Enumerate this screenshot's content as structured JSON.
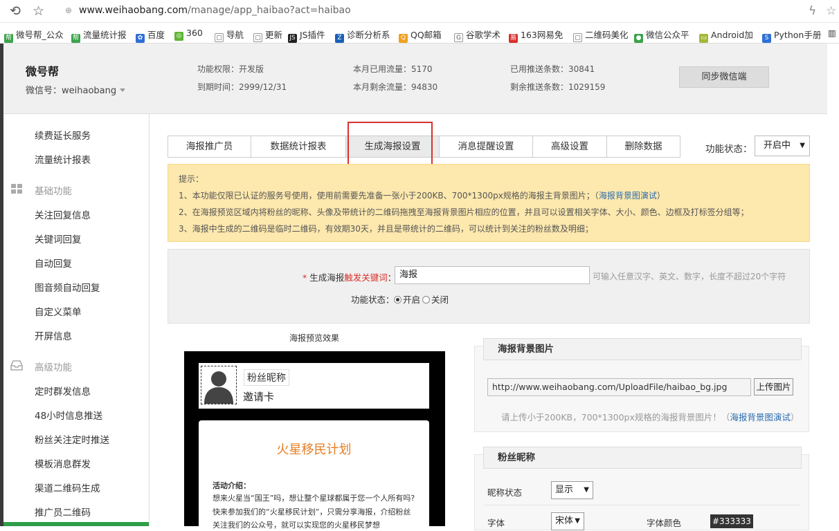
{
  "browser": {
    "url_host": "www.weihaobang.com",
    "url_path": "/manage/app_haibao?act=haibao"
  },
  "bookmarks": [
    {
      "label": "微号帮_公众",
      "color": "#3aa34a",
      "glyph": "帮"
    },
    {
      "label": "流量统计报",
      "color": "#3aa34a",
      "glyph": "帮"
    },
    {
      "label": "百度",
      "color": "#2f6fd6",
      "glyph": "✿"
    },
    {
      "label": "360",
      "color": "#5cb531",
      "glyph": "◎"
    },
    {
      "label": "导航",
      "color": "#ffffff",
      "glyph": "▢"
    },
    {
      "label": "更新",
      "color": "#ffffff",
      "glyph": "▢"
    },
    {
      "label": "JS插件",
      "color": "#222222",
      "glyph": "JS"
    },
    {
      "label": "诊断分析系",
      "color": "#1b5fb8",
      "glyph": "Z"
    },
    {
      "label": "QQ邮箱",
      "color": "#f0a020",
      "glyph": "Q"
    },
    {
      "label": "谷歌学术",
      "color": "#ffffff",
      "glyph": "G"
    },
    {
      "label": "163网易免",
      "color": "#d9302c",
      "glyph": "易"
    },
    {
      "label": "二维码美化",
      "color": "#ffffff",
      "glyph": "▢"
    },
    {
      "label": "微信公众平",
      "color": "#3aa34a",
      "glyph": "●"
    },
    {
      "label": "Android加",
      "color": "#a4b83a",
      "glyph": "▭"
    },
    {
      "label": "Python手册",
      "color": "#2f6fd6",
      "glyph": "S"
    }
  ],
  "header": {
    "title": "微号帮",
    "wechat_id": "微信号：weihaobang",
    "permission": "功能权限：开发版",
    "expire": "到期时间：2999/12/31",
    "used_traffic": "本月已用流量：5170",
    "remain_traffic": "本月剩余流量：94830",
    "used_push": "已用推送条数：30841",
    "remain_push": "剩余推送条数：1029159",
    "sync_button": "同步微信端"
  },
  "sidebar": {
    "items_top": [
      "续费延长服务",
      "流量统计报表"
    ],
    "group_basic": "基础功能",
    "items_basic": [
      "关注回复信息",
      "关键词回复",
      "自动回复",
      "图音频自动回复",
      "自定义菜单",
      "开屏信息"
    ],
    "group_advanced": "高级功能",
    "items_advanced": [
      "定时群发信息",
      "48小时信息推送",
      "粉丝关注定时推送",
      "模板消息群发",
      "渠道二维码生成",
      "推广员二维码"
    ]
  },
  "tabs": [
    "海报推广员",
    "数据统计报表",
    "生成海报设置",
    "消息提醒设置",
    "高级设置",
    "删除数据"
  ],
  "active_tab": "生成海报设置",
  "function_state": {
    "label": "功能状态：",
    "value": "开启中"
  },
  "tips": {
    "title": "提示：",
    "line1": "1、本功能仅限已认证的服务号使用，使用前需要先准备一张小于200KB、700*1300px规格的海报主背景图片；（",
    "line1_link": "海报背景图演试",
    "line1_end": "）",
    "line2": "2、在海报预览区域内将粉丝的昵称、头像及带统计的二维码拖拽至海报背景图片相应的位置，并且可以设置相关字体、大小、颜色、边框及打标签分组等；",
    "line3": "3、海报中生成的二维码是临时二维码，有效期30天，并且是带统计的二维码，可以统计到关注的粉丝数及明细；"
  },
  "form": {
    "keyword_label_pre": "生成海报",
    "keyword_label_red": "触发关键词",
    "keyword_label_colon": "：",
    "keyword_value": "海报",
    "keyword_hint": "可输入任意汉字、英文、数字，长度不超过20个字符",
    "state_label": "功能状态：",
    "state_on": "开启",
    "state_off": "关闭"
  },
  "preview": {
    "title": "海报预览效果",
    "nickname": "粉丝昵称",
    "invite": "邀请卡",
    "headline": "火星移民计划",
    "intro_title": "活动介绍：",
    "intro_1": "想来火星当“国王”吗，想让整个星球都属于您一个人所有吗?",
    "intro_2": "快来参加我们的“火星移民计划”，只需分享海报，介绍粉丝",
    "intro_3": "关注我们的公众号，就可以实现您的火星移民梦想"
  },
  "bg_panel": {
    "title": "海报背景图片",
    "url_value": "http://www.weihaobang.com/UploadFile/haibao_bg.jpg",
    "upload_button": "上传图片",
    "hint": "请上传小于200KB，700*1300px规格的海报背景图片！（",
    "hint_link": "海报背景图演试",
    "hint_end": "）"
  },
  "nick_panel": {
    "title": "粉丝昵称",
    "status_label": "昵称状态",
    "status_value": "显示",
    "font_label": "字体",
    "font_value": "宋体",
    "color_label": "字体颜色",
    "color_value": "#333333"
  }
}
